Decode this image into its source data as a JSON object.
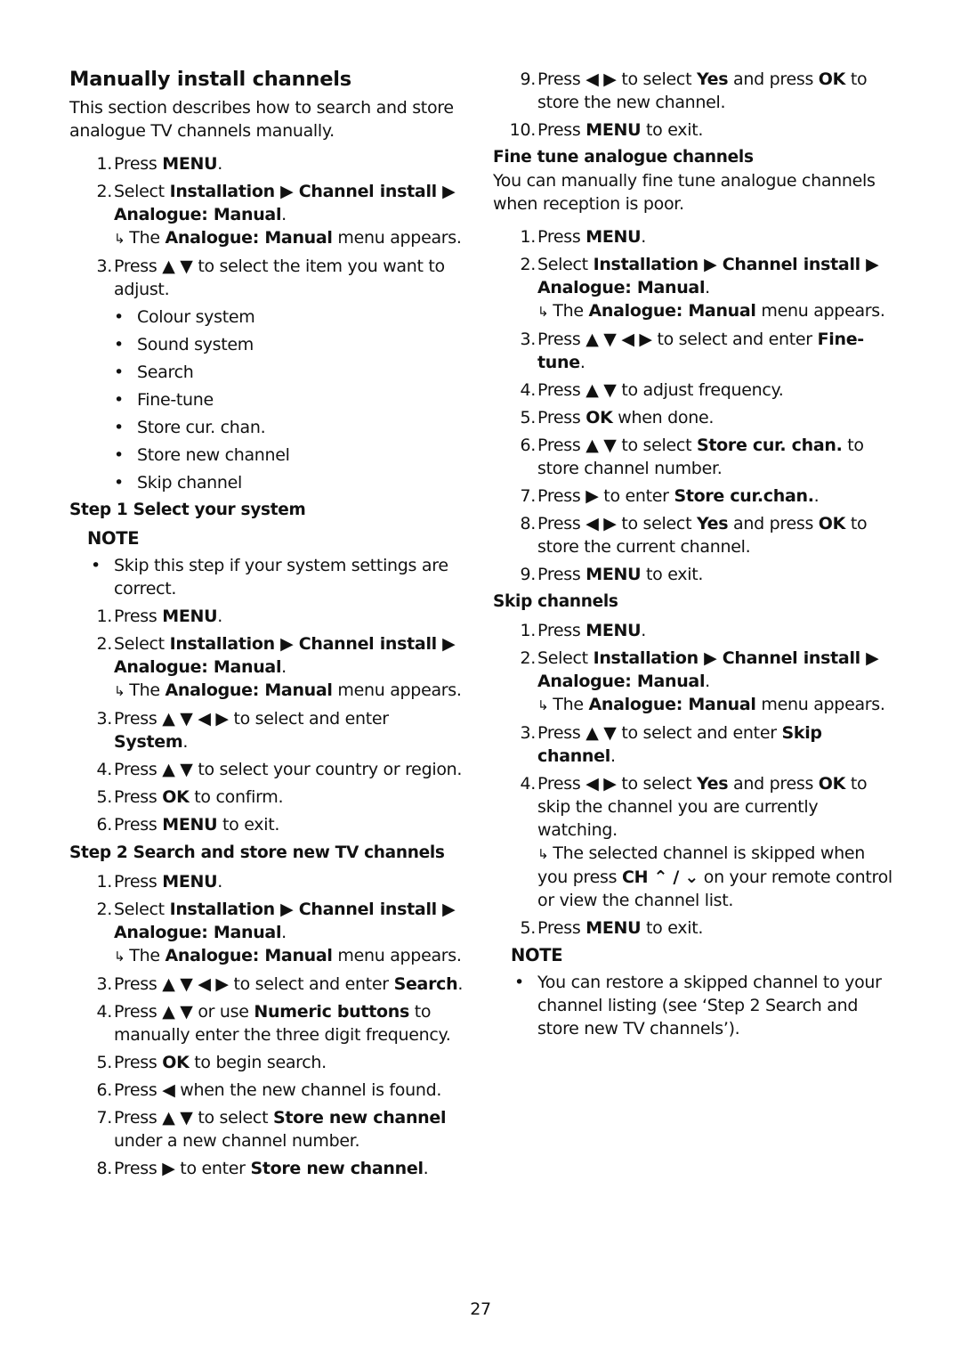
{
  "page": {
    "title": "Manually install channels",
    "intro": "This section describes how to search and store analogue TV channels manually.",
    "page_number": "27"
  },
  "icons": {
    "up": "▲",
    "down": "▼",
    "left": "◀",
    "right": "▶",
    "result_arrow": "↳",
    "bullet": "•",
    "ch_up": "⌃",
    "ch_down": "⌄"
  },
  "intro_steps": [
    {
      "num": "1.",
      "segments": [
        {
          "t": "Press "
        },
        {
          "t": "MENU",
          "b": true
        },
        {
          "t": "."
        }
      ]
    },
    {
      "num": "2.",
      "segments": [
        {
          "t": "Select "
        },
        {
          "t": "Installation ▶ Channel install ▶ Analogue: Manual",
          "b": true
        },
        {
          "t": "."
        }
      ],
      "result": [
        {
          "t": "The "
        },
        {
          "t": "Analogue: Manual",
          "b": true
        },
        {
          "t": " menu appears."
        }
      ]
    },
    {
      "num": "3.",
      "segments": [
        {
          "t": "Press ▲ ▼ to select the item you want to adjust."
        }
      ]
    }
  ],
  "menu_items": [
    "Colour system",
    "Sound system",
    "Search",
    "Fine-tune",
    "Store cur. chan.",
    "Store new channel",
    "Skip channel"
  ],
  "step1": {
    "heading": "Step 1 Select your system",
    "note_label": "NOTE",
    "note_items": [
      "Skip this step if your system settings are correct."
    ],
    "steps": [
      {
        "num": "1.",
        "segments": [
          {
            "t": "Press "
          },
          {
            "t": "MENU",
            "b": true
          },
          {
            "t": "."
          }
        ]
      },
      {
        "num": "2.",
        "segments": [
          {
            "t": "Select "
          },
          {
            "t": "Installation ▶ Channel install ▶ Analogue: Manual",
            "b": true
          },
          {
            "t": "."
          }
        ],
        "result": [
          {
            "t": "The "
          },
          {
            "t": "Analogue: Manual",
            "b": true
          },
          {
            "t": " menu appears."
          }
        ]
      },
      {
        "num": "3.",
        "segments": [
          {
            "t": "Press ▲ ▼ ◀ ▶ to select and enter "
          },
          {
            "t": "System",
            "b": true
          },
          {
            "t": "."
          }
        ]
      },
      {
        "num": "4.",
        "segments": [
          {
            "t": "Press ▲ ▼ to select your country or region."
          }
        ]
      },
      {
        "num": "5.",
        "segments": [
          {
            "t": "Press "
          },
          {
            "t": "OK",
            "b": true
          },
          {
            "t": " to confirm."
          }
        ]
      },
      {
        "num": "6.",
        "segments": [
          {
            "t": "Press "
          },
          {
            "t": "MENU",
            "b": true
          },
          {
            "t": " to exit."
          }
        ]
      }
    ]
  },
  "step2": {
    "heading": "Step 2 Search and store new TV channels",
    "steps": [
      {
        "num": "1.",
        "segments": [
          {
            "t": "Press "
          },
          {
            "t": "MENU",
            "b": true
          },
          {
            "t": "."
          }
        ]
      },
      {
        "num": "2.",
        "segments": [
          {
            "t": "Select "
          },
          {
            "t": "Installation ▶ Channel install ▶ Analogue: Manual",
            "b": true
          },
          {
            "t": "."
          }
        ],
        "result": [
          {
            "t": "The "
          },
          {
            "t": "Analogue: Manual",
            "b": true
          },
          {
            "t": " menu appears."
          }
        ]
      },
      {
        "num": "3.",
        "segments": [
          {
            "t": "Press ▲ ▼ ◀ ▶ to select and enter "
          },
          {
            "t": "Search",
            "b": true
          },
          {
            "t": "."
          }
        ]
      },
      {
        "num": "4.",
        "segments": [
          {
            "t": "Press ▲ ▼ or use "
          },
          {
            "t": "Numeric buttons",
            "b": true
          },
          {
            "t": " to manually enter the three digit frequency."
          }
        ]
      },
      {
        "num": "5.",
        "segments": [
          {
            "t": "Press "
          },
          {
            "t": "OK",
            "b": true
          },
          {
            "t": " to begin search."
          }
        ]
      },
      {
        "num": "6.",
        "segments": [
          {
            "t": "Press ◀ when the new channel is found."
          }
        ]
      },
      {
        "num": "7.",
        "segments": [
          {
            "t": "Press ▲ ▼ to select "
          },
          {
            "t": "Store new channel",
            "b": true
          },
          {
            "t": " under a new channel number."
          }
        ]
      },
      {
        "num": "8.",
        "segments": [
          {
            "t": "Press ▶ to enter "
          },
          {
            "t": "Store new channel",
            "b": true
          },
          {
            "t": "."
          }
        ]
      },
      {
        "num": "9.",
        "segments": [
          {
            "t": "Press ◀ ▶ to select "
          },
          {
            "t": "Yes",
            "b": true
          },
          {
            "t": " and press "
          },
          {
            "t": "OK",
            "b": true
          },
          {
            "t": " to store the new channel."
          }
        ]
      },
      {
        "num": "10.",
        "segments": [
          {
            "t": "Press "
          },
          {
            "t": "MENU",
            "b": true
          },
          {
            "t": " to exit."
          }
        ]
      }
    ]
  },
  "fine_tune": {
    "heading": "Fine tune analogue channels",
    "intro": "You can manually fine tune analogue channels when reception is poor.",
    "steps": [
      {
        "num": "1.",
        "segments": [
          {
            "t": "Press "
          },
          {
            "t": "MENU",
            "b": true
          },
          {
            "t": "."
          }
        ]
      },
      {
        "num": "2.",
        "segments": [
          {
            "t": "Select "
          },
          {
            "t": "Installation ▶ Channel install ▶ Analogue: Manual",
            "b": true
          },
          {
            "t": "."
          }
        ],
        "result": [
          {
            "t": "The "
          },
          {
            "t": "Analogue: Manual",
            "b": true
          },
          {
            "t": " menu appears."
          }
        ]
      },
      {
        "num": "3.",
        "segments": [
          {
            "t": "Press ▲ ▼ ◀ ▶ to select and enter "
          },
          {
            "t": "Fine-tune",
            "b": true
          },
          {
            "t": "."
          }
        ]
      },
      {
        "num": "4.",
        "segments": [
          {
            "t": "Press ▲ ▼ to adjust frequency."
          }
        ]
      },
      {
        "num": "5.",
        "segments": [
          {
            "t": "Press "
          },
          {
            "t": "OK",
            "b": true
          },
          {
            "t": " when done."
          }
        ]
      },
      {
        "num": "6.",
        "segments": [
          {
            "t": "Press ▲ ▼ to select "
          },
          {
            "t": "Store cur. chan.",
            "b": true
          },
          {
            "t": " to store channel number."
          }
        ]
      },
      {
        "num": "7.",
        "segments": [
          {
            "t": "Press ▶ to enter "
          },
          {
            "t": "Store cur.chan.",
            "b": true
          },
          {
            "t": "."
          }
        ]
      },
      {
        "num": "8.",
        "segments": [
          {
            "t": "Press ◀ ▶ to select "
          },
          {
            "t": "Yes",
            "b": true
          },
          {
            "t": " and press "
          },
          {
            "t": "OK",
            "b": true
          },
          {
            "t": " to store the current channel."
          }
        ]
      },
      {
        "num": "9.",
        "segments": [
          {
            "t": "Press "
          },
          {
            "t": "MENU",
            "b": true
          },
          {
            "t": " to exit."
          }
        ]
      }
    ]
  },
  "skip": {
    "heading": "Skip channels",
    "steps": [
      {
        "num": "1.",
        "segments": [
          {
            "t": "Press "
          },
          {
            "t": "MENU",
            "b": true
          },
          {
            "t": "."
          }
        ]
      },
      {
        "num": "2.",
        "segments": [
          {
            "t": "Select "
          },
          {
            "t": "Installation ▶ Channel install ▶ Analogue: Manual",
            "b": true
          },
          {
            "t": "."
          }
        ],
        "result": [
          {
            "t": "The "
          },
          {
            "t": "Analogue: Manual",
            "b": true
          },
          {
            "t": " menu appears."
          }
        ]
      },
      {
        "num": "3.",
        "segments": [
          {
            "t": "Press ▲ ▼ to select and enter "
          },
          {
            "t": "Skip channel",
            "b": true
          },
          {
            "t": "."
          }
        ]
      },
      {
        "num": "4.",
        "segments": [
          {
            "t": "Press ◀ ▶ to select "
          },
          {
            "t": "Yes",
            "b": true
          },
          {
            "t": " and press "
          },
          {
            "t": "OK",
            "b": true
          },
          {
            "t": " to skip the channel you are currently watching."
          }
        ],
        "result": [
          {
            "t": "The selected channel is skipped when you press "
          },
          {
            "t": "CH ⌃ / ⌄",
            "b": true
          },
          {
            "t": " on your remote control or view the channel list."
          }
        ]
      },
      {
        "num": "5.",
        "segments": [
          {
            "t": "Press "
          },
          {
            "t": "MENU",
            "b": true
          },
          {
            "t": " to exit."
          }
        ]
      }
    ],
    "note_label": "NOTE",
    "note_items": [
      "You can restore a skipped channel to your channel listing (see ‘Step 2 Search and store new TV channels’)."
    ]
  }
}
